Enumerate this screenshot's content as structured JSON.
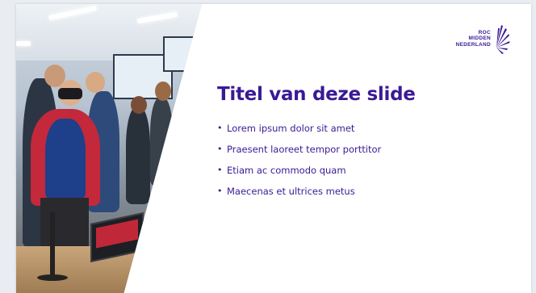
{
  "slide": {
    "title": "Titel van deze slide",
    "bullets": [
      "Lorem ipsum dolor sit amet",
      "Praesent laoreet tempor porttitor",
      "Etiam ac commodo quam",
      "Maecenas et ultrices metus"
    ],
    "logo": {
      "lines": [
        "ROC",
        "MIDDEN",
        "NEDERLAND"
      ],
      "icon": "fan-leaf-icon"
    },
    "photo": "classroom-vr-photo"
  },
  "colors": {
    "brand": "#3a1a94",
    "background": "#e9edf2",
    "slide": "#ffffff"
  }
}
